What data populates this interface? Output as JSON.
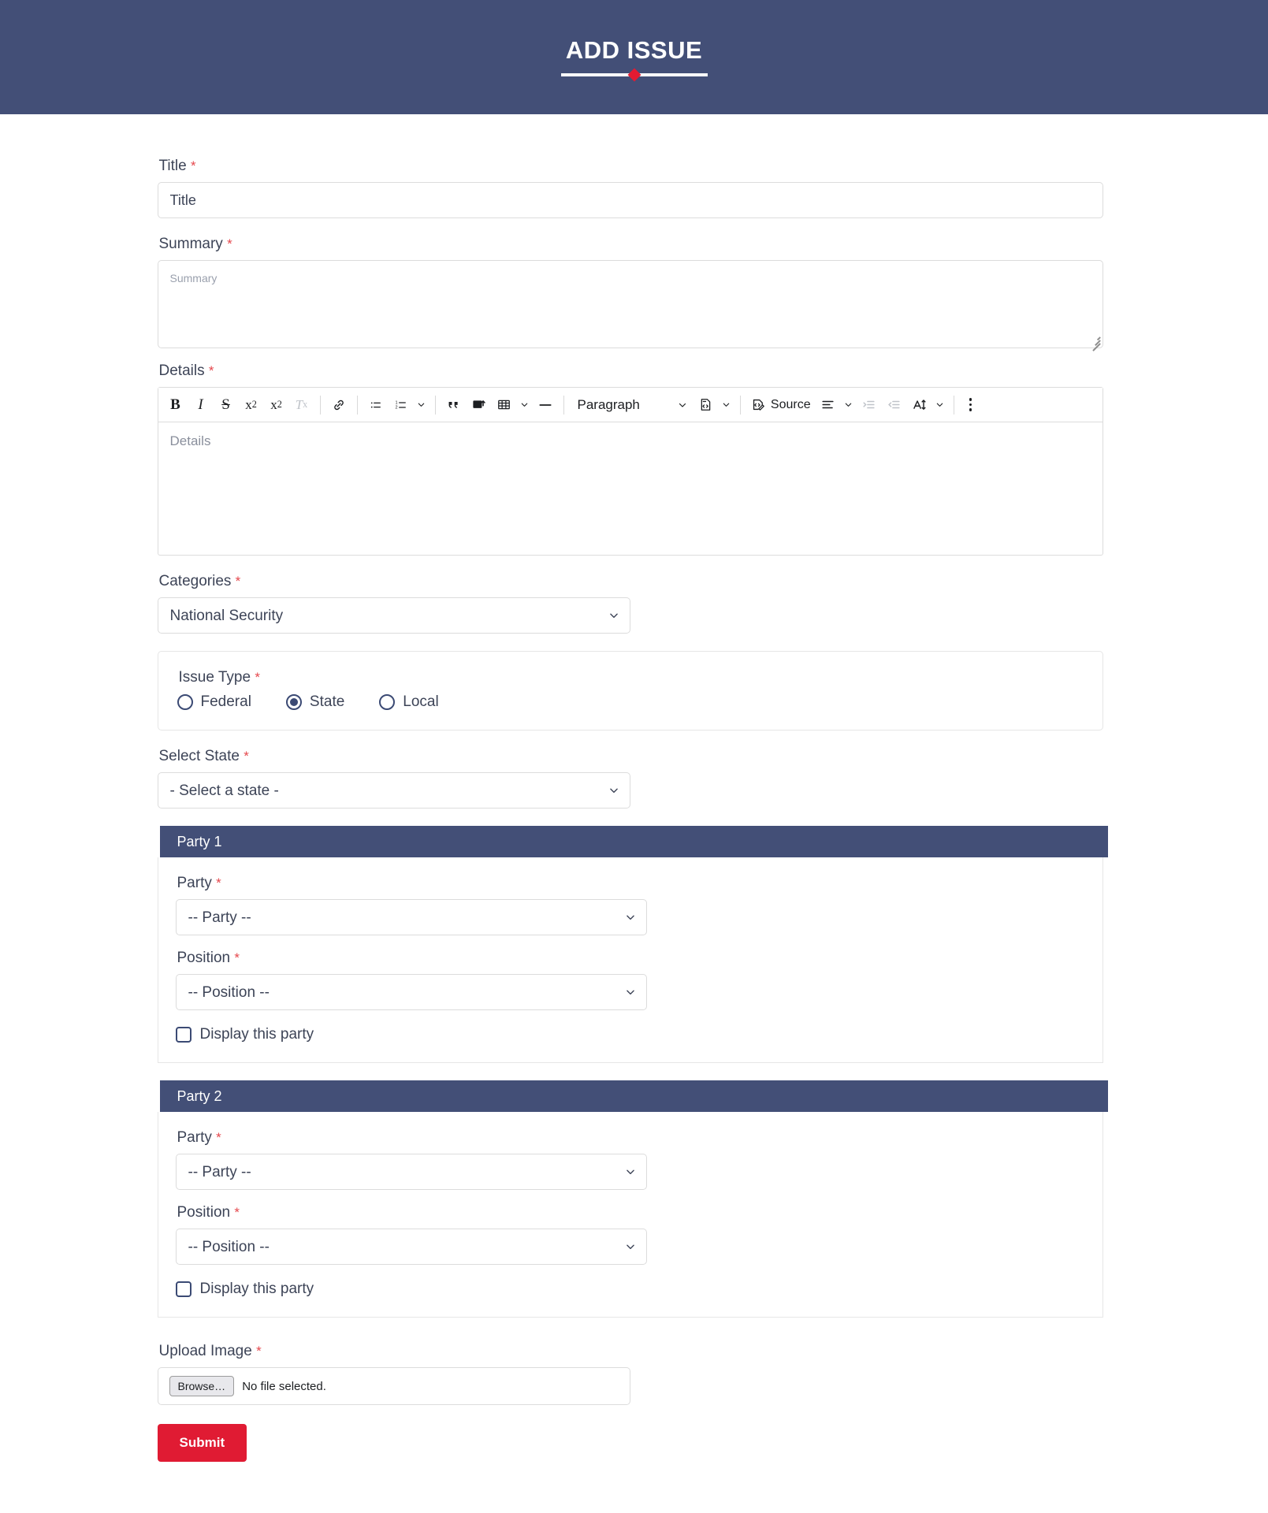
{
  "header": {
    "title": "ADD ISSUE"
  },
  "form": {
    "title_field": {
      "label": "Title",
      "required_mark": "*",
      "placeholder": "Title",
      "value": ""
    },
    "summary_field": {
      "label": "Summary",
      "required_mark": "*",
      "placeholder": "Summary",
      "value": ""
    },
    "details_field": {
      "label": "Details",
      "required_mark": "*",
      "placeholder": "Details",
      "value": ""
    },
    "categories_field": {
      "label": "Categories",
      "required_mark": "*",
      "selected": "National Security"
    },
    "issue_type": {
      "label": "Issue Type",
      "required_mark": "*",
      "options": [
        {
          "label": "Federal",
          "selected": false
        },
        {
          "label": "State",
          "selected": true
        },
        {
          "label": "Local",
          "selected": false
        }
      ]
    },
    "select_state_field": {
      "label": "Select State",
      "required_mark": "*",
      "selected": "- Select a state -"
    },
    "parties": [
      {
        "header": "Party 1",
        "party_label": "Party",
        "party_required": "*",
        "party_selected": "-- Party --",
        "position_label": "Position",
        "position_required": "*",
        "position_selected": "-- Position --",
        "display_label": "Display this party",
        "display_checked": false
      },
      {
        "header": "Party 2",
        "party_label": "Party",
        "party_required": "*",
        "party_selected": "-- Party --",
        "position_label": "Position",
        "position_required": "*",
        "position_selected": "-- Position --",
        "display_label": "Display this party",
        "display_checked": false
      }
    ],
    "upload_field": {
      "label": "Upload Image",
      "required_mark": "*",
      "browse_label": "Browse…",
      "status": "No file selected."
    },
    "submit_label": "Submit"
  },
  "editor_toolbar": {
    "bold": "B",
    "italic": "I",
    "strikethrough": "S",
    "superscript_base": "x",
    "superscript_exp": "2",
    "subscript_base": "x",
    "subscript_exp": "2",
    "remove_format": "T",
    "remove_format_mark": "x",
    "link": "link-icon",
    "bulleted_list": "bulleted-list-icon",
    "numbered_list": "numbered-list-icon",
    "blockquote": "blockquote-icon",
    "insert_image": "insert-image-icon",
    "insert_table": "insert-table-icon",
    "horizontal_line": "horizontal-line-icon",
    "paragraph_label": "Paragraph",
    "code_block": "code-block-icon",
    "source_label": "Source",
    "source_icon": "source-code-icon",
    "text_align": "text-align-icon",
    "indent": "indent-icon",
    "outdent": "outdent-icon",
    "font_size": "font-size-icon",
    "overflow": "kebab-menu-icon"
  },
  "colors": {
    "navy": "#434f77",
    "red": "#e01b33",
    "accent_red": "#e31b32",
    "text": "#3d4457",
    "border": "#dcdcdc"
  }
}
